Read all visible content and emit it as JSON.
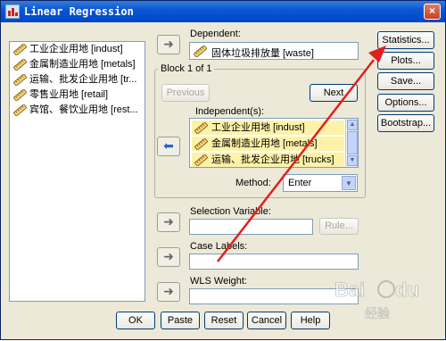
{
  "window": {
    "title": "Linear Regression",
    "close_glyph": "×"
  },
  "variables": [
    "工业企业用地 [indust]",
    "金属制造业用地 [metals]",
    "运输、批发企业用地 [tr...",
    "零售业用地 [retail]",
    "宾馆、餐饮业用地 [rest..."
  ],
  "dependent": {
    "label": "Dependent:",
    "value": "固体垃圾排放量 [waste]"
  },
  "block": {
    "title": "Block 1 of 1",
    "previous_label": "Previous",
    "next_label": "Next",
    "independent_label": "Independent(s):",
    "independents": [
      "工业企业用地 [indust]",
      "金属制造业用地 [metals]",
      "运输、批发企业用地 [trucks]"
    ],
    "method_label": "Method:",
    "method_value": "Enter"
  },
  "selection": {
    "label": "Selection Variable:",
    "rule_label": "Rule..."
  },
  "case_labels": {
    "label": "Case Labels:"
  },
  "wls": {
    "label": "WLS Weight:"
  },
  "side_buttons": [
    "Statistics...",
    "Plots...",
    "Save...",
    "Options...",
    "Bootstrap..."
  ],
  "bottom_buttons": [
    "OK",
    "Paste",
    "Reset",
    "Cancel",
    "Help"
  ],
  "watermark": {
    "text": "Bai du 经验"
  },
  "colors": {
    "annotation_arrow": "#e02020",
    "title_bar": "#0a58d6",
    "selected_highlight": "#fdf2a8"
  },
  "icons": {
    "variable": "ruler-icon",
    "move": "arrow-right-icon",
    "move_back": "arrow-left-icon"
  }
}
